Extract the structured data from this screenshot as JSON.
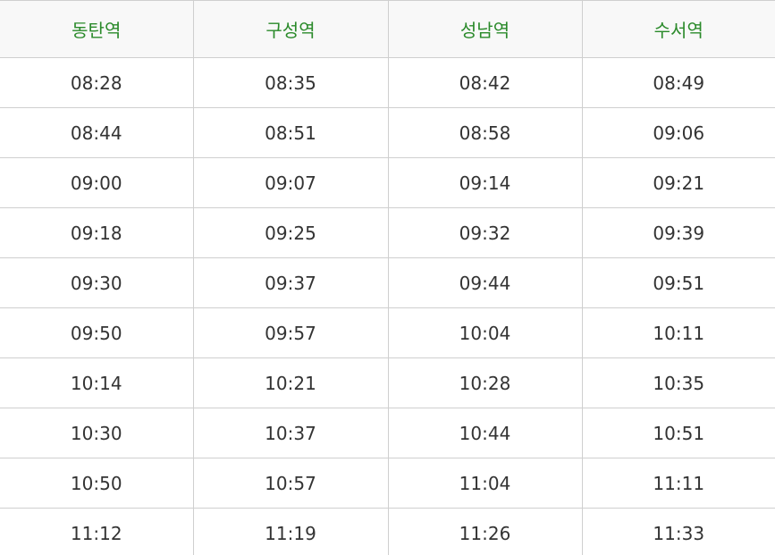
{
  "colors": {
    "header_text": "#2a8a2a",
    "header_background": "#f8f8f8",
    "cell_text": "#333333",
    "border": "#cfcfcf"
  },
  "table": {
    "headers": [
      "동탄역",
      "구성역",
      "성남역",
      "수서역"
    ],
    "rows": [
      [
        "08:28",
        "08:35",
        "08:42",
        "08:49"
      ],
      [
        "08:44",
        "08:51",
        "08:58",
        "09:06"
      ],
      [
        "09:00",
        "09:07",
        "09:14",
        "09:21"
      ],
      [
        "09:18",
        "09:25",
        "09:32",
        "09:39"
      ],
      [
        "09:30",
        "09:37",
        "09:44",
        "09:51"
      ],
      [
        "09:50",
        "09:57",
        "10:04",
        "10:11"
      ],
      [
        "10:14",
        "10:21",
        "10:28",
        "10:35"
      ],
      [
        "10:30",
        "10:37",
        "10:44",
        "10:51"
      ],
      [
        "10:50",
        "10:57",
        "11:04",
        "11:11"
      ],
      [
        "11:12",
        "11:19",
        "11:26",
        "11:33"
      ]
    ]
  }
}
